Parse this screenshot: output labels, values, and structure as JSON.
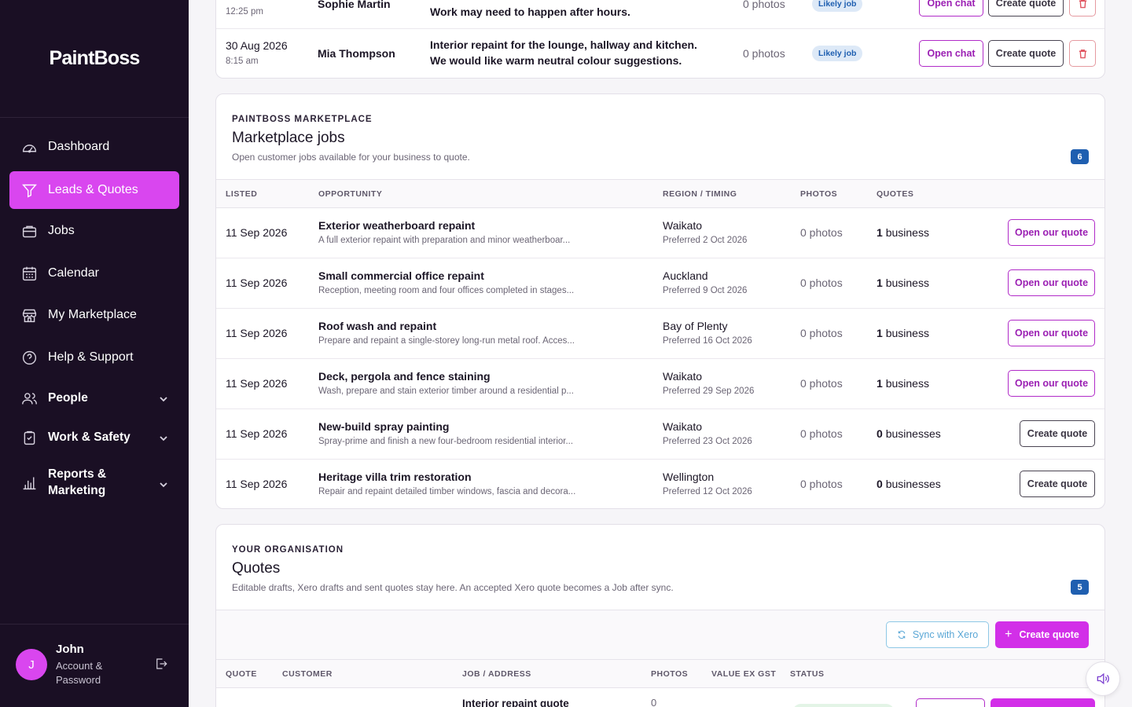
{
  "app": {
    "name": "PaintBoss"
  },
  "sidebar": {
    "items": [
      {
        "label": "Dashboard",
        "icon": "gauge-icon"
      },
      {
        "label": "Leads & Quotes",
        "icon": "filter-icon",
        "active": true
      },
      {
        "label": "Jobs",
        "icon": "briefcase-icon"
      },
      {
        "label": "Calendar",
        "icon": "calendar-icon"
      },
      {
        "label": "My Marketplace",
        "icon": "store-icon"
      },
      {
        "label": "Help & Support",
        "icon": "help-icon"
      }
    ],
    "groups": [
      {
        "label": "People",
        "icon": "people-icon"
      },
      {
        "label": "Work & Safety",
        "icon": "clipboard-icon"
      },
      {
        "label_line1": "Reports &",
        "label_line2": "Marketing",
        "icon": "bar-chart-icon"
      }
    ],
    "user": {
      "initial": "J",
      "name": "John",
      "sub": "Account & Password"
    }
  },
  "leads": {
    "rows": [
      {
        "date": "",
        "time": "12:25 pm",
        "name": "Sophie Martin",
        "message_line1": "",
        "message_line2": "Work may need to happen after hours.",
        "photos": "0 photos",
        "status": "Likely job",
        "open_chat": "Open chat",
        "create_quote": "Create quote"
      },
      {
        "date": "30 Aug 2026",
        "time": "8:15 am",
        "name": "Mia Thompson",
        "message_line1": "Interior repaint for the lounge, hallway and kitchen.",
        "message_line2": "We would like warm neutral colour suggestions.",
        "photos": "0 photos",
        "status": "Likely job",
        "open_chat": "Open chat",
        "create_quote": "Create quote"
      }
    ]
  },
  "marketplace": {
    "eyebrow": "PAINTBOSS MARKETPLACE",
    "title": "Marketplace jobs",
    "description": "Open customer jobs available for your business to quote.",
    "count": "6",
    "columns": [
      "LISTED",
      "OPPORTUNITY",
      "REGION / TIMING",
      "PHOTOS",
      "QUOTES"
    ],
    "rows": [
      {
        "listed": "11 Sep 2026",
        "title": "Exterior weatherboard repaint",
        "desc": "A full exterior repaint with preparation and minor weatherboar...",
        "region": "Waikato",
        "preferred": "Preferred 2 Oct 2026",
        "photos": "0 photos",
        "quotes_count": "1",
        "quotes_unit": "business",
        "action": "Open our quote",
        "action_style": "purple"
      },
      {
        "listed": "11 Sep 2026",
        "title": "Small commercial office repaint",
        "desc": "Reception, meeting room and four offices completed in stages...",
        "region": "Auckland",
        "preferred": "Preferred 9 Oct 2026",
        "photos": "0 photos",
        "quotes_count": "1",
        "quotes_unit": "business",
        "action": "Open our quote",
        "action_style": "purple"
      },
      {
        "listed": "11 Sep 2026",
        "title": "Roof wash and repaint",
        "desc": "Prepare and repaint a single-storey long-run metal roof. Acces...",
        "region": "Bay of Plenty",
        "preferred": "Preferred 16 Oct 2026",
        "photos": "0 photos",
        "quotes_count": "1",
        "quotes_unit": "business",
        "action": "Open our quote",
        "action_style": "purple"
      },
      {
        "listed": "11 Sep 2026",
        "title": "Deck, pergola and fence staining",
        "desc": "Wash, prepare and stain exterior timber around a residential p...",
        "region": "Waikato",
        "preferred": "Preferred 29 Sep 2026",
        "photos": "0 photos",
        "quotes_count": "1",
        "quotes_unit": "business",
        "action": "Open our quote",
        "action_style": "purple"
      },
      {
        "listed": "11 Sep 2026",
        "title": "New-build spray painting",
        "desc": "Spray-prime and finish a new four-bedroom residential interior...",
        "region": "Waikato",
        "preferred": "Preferred 23 Oct 2026",
        "photos": "0 photos",
        "quotes_count": "0",
        "quotes_unit": "businesses",
        "action": "Create quote",
        "action_style": "dark"
      },
      {
        "listed": "11 Sep 2026",
        "title": "Heritage villa trim restoration",
        "desc": "Repair and repaint detailed timber windows, fascia and decora...",
        "region": "Wellington",
        "preferred": "Preferred 12 Oct 2026",
        "photos": "0 photos",
        "quotes_count": "0",
        "quotes_unit": "businesses",
        "action": "Create quote",
        "action_style": "dark"
      }
    ]
  },
  "quotes": {
    "eyebrow": "YOUR ORGANISATION",
    "title": "Quotes",
    "description": "Editable drafts, Xero drafts and sent quotes stay here. An accepted Xero quote becomes a Job after sync.",
    "count": "5",
    "sync_label": "Sync with Xero",
    "create_label": "Create quote",
    "columns": [
      "QUOTE",
      "CUSTOMER",
      "JOB / ADDRESS",
      "PHOTOS",
      "VALUE EX GST",
      "STATUS"
    ],
    "first_row": {
      "job": "Interior repaint quote",
      "photos": "0"
    }
  },
  "colors": {
    "accent": "#d946ef",
    "sidebar_bg": "#1a0f24",
    "badge_blue": "#1f5fb0"
  }
}
